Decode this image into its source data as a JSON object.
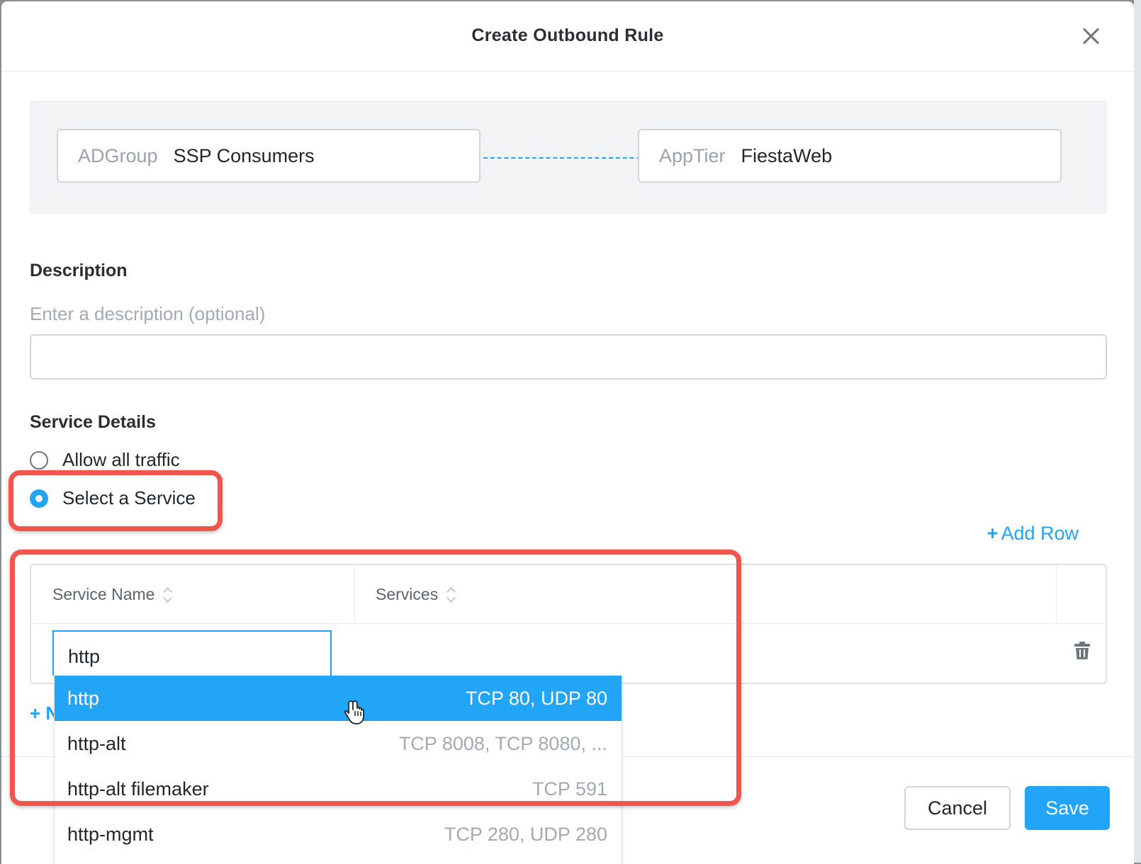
{
  "modal": {
    "title": "Create Outbound Rule"
  },
  "flow": {
    "source": {
      "kind": "ADGroup",
      "value": "SSP Consumers"
    },
    "target": {
      "kind": "AppTier",
      "value": "FiestaWeb"
    }
  },
  "description": {
    "title": "Description",
    "hint": "Enter a description (optional)",
    "value": ""
  },
  "service_details": {
    "title": "Service Details",
    "options": [
      {
        "label": "Allow all traffic",
        "selected": false
      },
      {
        "label": "Select a Service",
        "selected": true
      }
    ],
    "add_row_label": "Add Row",
    "table": {
      "columns": [
        "Service Name",
        "Services"
      ],
      "input_value": "http"
    },
    "add_stub": "+ N"
  },
  "dropdown": {
    "items": [
      {
        "name": "http",
        "ports": "TCP 80, UDP 80",
        "active": true
      },
      {
        "name": "http-alt",
        "ports": "TCP 8008, TCP 8080, ...",
        "active": false
      },
      {
        "name": "http-alt filemaker",
        "ports": "TCP 591",
        "active": false
      },
      {
        "name": "http-mgmt",
        "ports": "TCP 280, UDP 280",
        "active": false
      }
    ]
  },
  "footer": {
    "cancel_label": "Cancel",
    "save_label": "Save"
  },
  "colors": {
    "accent": "#22a5f7",
    "highlight": "#f1564c"
  },
  "icons": [
    "close-icon",
    "sort-icon",
    "trash-icon",
    "plus-icon",
    "hand-cursor-icon"
  ]
}
